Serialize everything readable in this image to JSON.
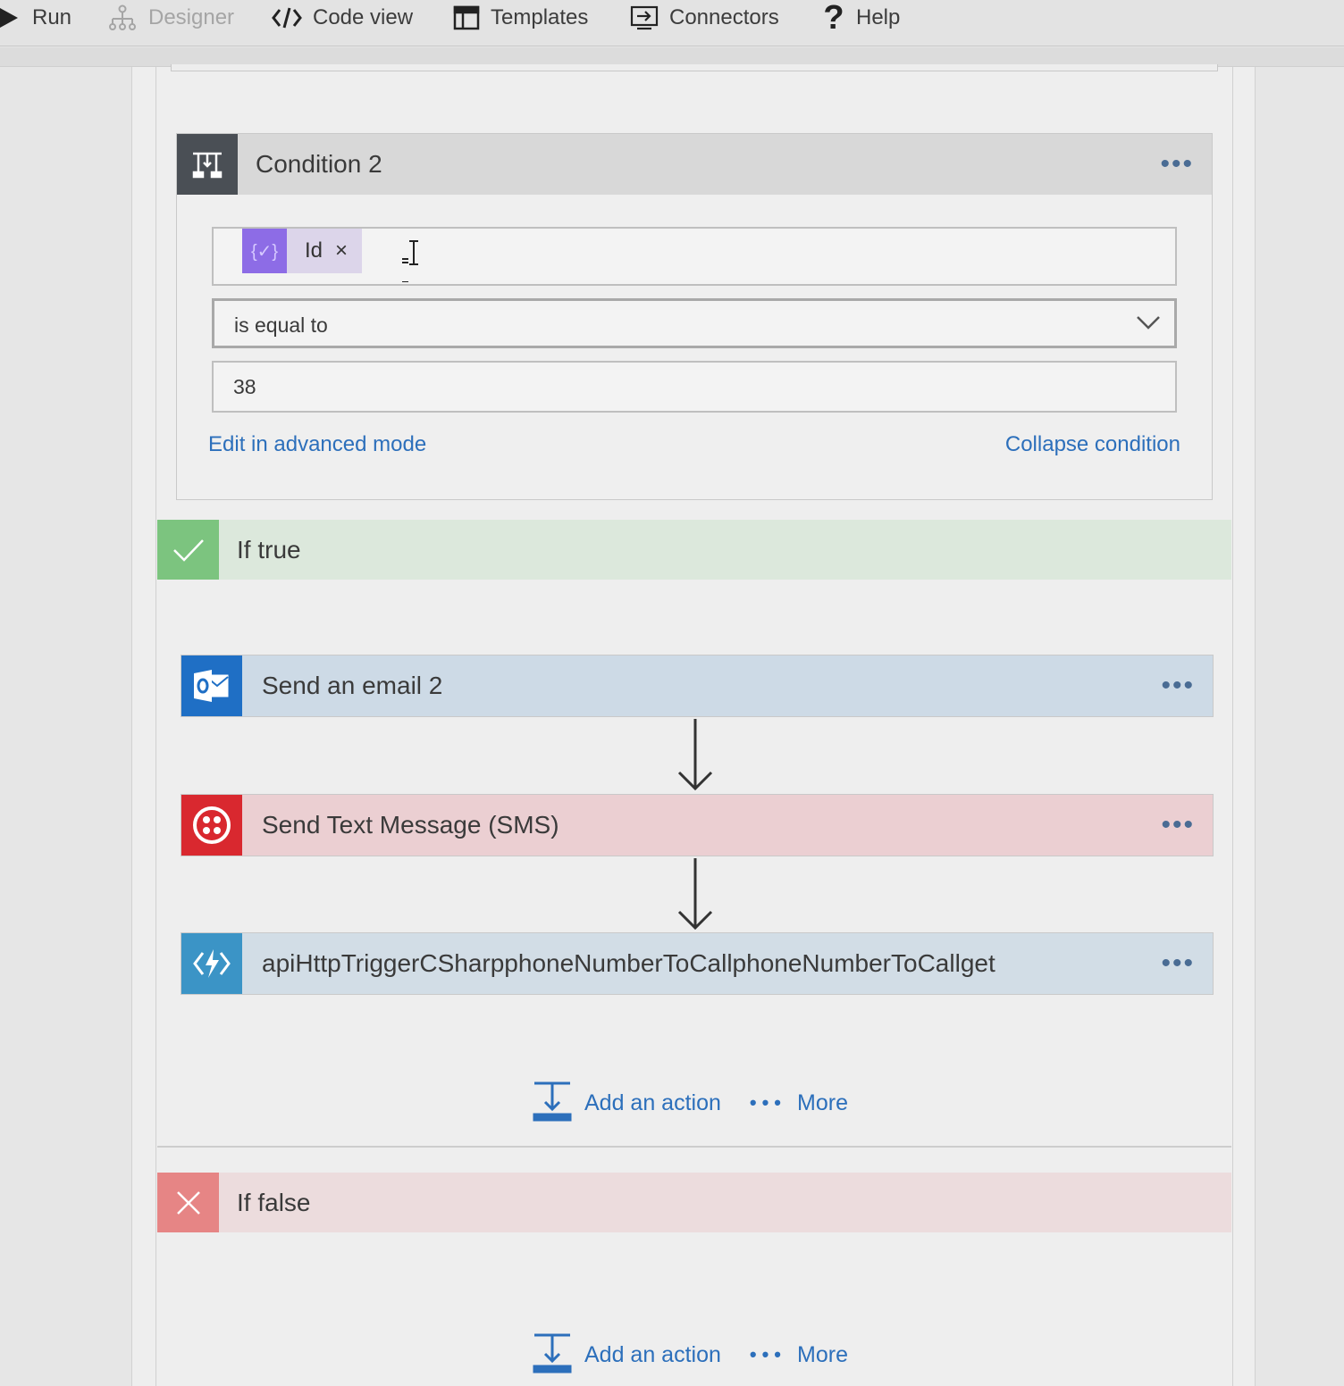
{
  "toolbar": {
    "run": "Run",
    "designer": "Designer",
    "code_view": "Code view",
    "templates": "Templates",
    "connectors": "Connectors",
    "help": "Help"
  },
  "condition": {
    "title": "Condition 2",
    "token_label": "Id",
    "token_remove": "×",
    "operator": "is equal to",
    "value": "38",
    "edit_advanced": "Edit in advanced mode",
    "collapse": "Collapse condition"
  },
  "if_true": {
    "label": "If true",
    "actions": [
      {
        "title": "Send an email 2",
        "icon": "outlook-icon"
      },
      {
        "title": "Send Text Message (SMS)",
        "icon": "twilio-icon"
      },
      {
        "title": "apiHttpTriggerCSharpphoneNumberToCallphoneNumberToCallget",
        "icon": "azure-function-icon"
      }
    ],
    "add_action": "Add an action",
    "more": "More"
  },
  "if_false": {
    "label": "If false",
    "add_action": "Add an action",
    "more": "More"
  },
  "menu_dots": "•••",
  "colors": {
    "link": "#2c6fbb",
    "true_green": "#7cc47f",
    "false_red": "#e68585",
    "outlook_blue": "#1f6fc5",
    "twilio_red": "#d9282f",
    "function_blue": "#3b94c6",
    "token_purple": "#8d6ce6"
  }
}
